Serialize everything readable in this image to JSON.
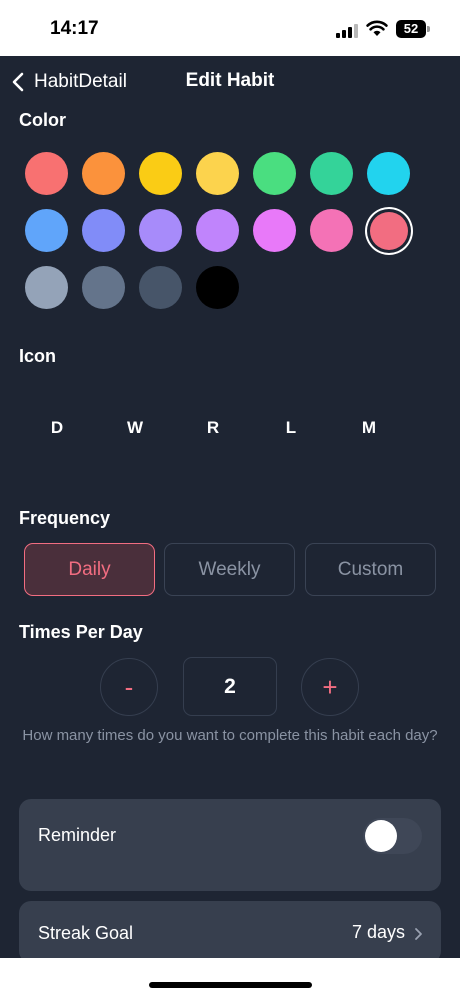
{
  "status_bar": {
    "time": "14:17",
    "battery": "52"
  },
  "nav": {
    "back_label": "HabitDetail",
    "title": "Edit Habit"
  },
  "color_section": {
    "title": "Color",
    "swatches": [
      "#f87171",
      "#fb923c",
      "#facc15",
      "#fcd34d",
      "#4ade80",
      "#34d399",
      "#22d3ee",
      "#60a5fa",
      "#818cf8",
      "#a78bfa",
      "#c084fc",
      "#e879f9",
      "#f472b6",
      "#f26d81",
      "#94a3b8",
      "#64748b",
      "#475569",
      "#000000"
    ],
    "selected_index": 13
  },
  "icon_section": {
    "title": "Icon",
    "options": [
      "D",
      "W",
      "R",
      "L",
      "M"
    ]
  },
  "frequency": {
    "title": "Frequency",
    "options": [
      "Daily",
      "Weekly",
      "Custom"
    ],
    "selected": "Daily"
  },
  "times_per_day": {
    "title": "Times Per Day",
    "decrement": "-",
    "increment": "+",
    "value": "2",
    "helper": "How many times do you want to complete this habit each day?"
  },
  "reminder": {
    "label": "Reminder",
    "enabled": false
  },
  "streak_goal": {
    "label": "Streak Goal",
    "value": "7 days"
  },
  "colors": {
    "accent": "#f26d81",
    "background": "#1e2533",
    "card": "#373f4e"
  }
}
